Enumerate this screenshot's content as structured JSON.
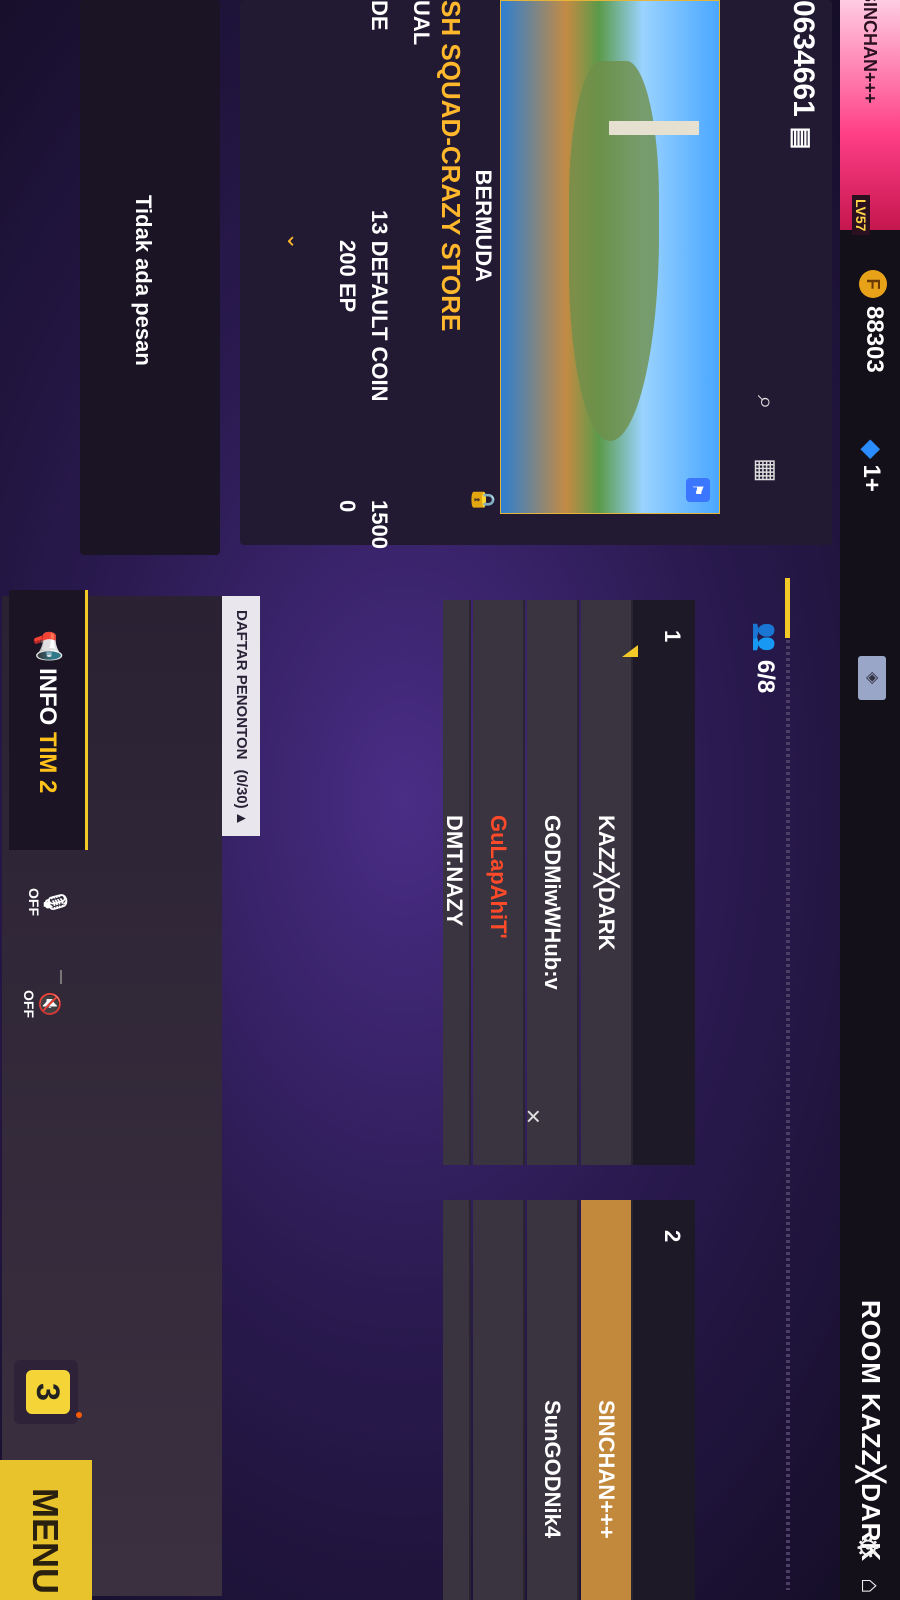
{
  "header": {
    "room_title": "ROOM KAZZ╳DARK",
    "gear_icon": "gear-icon",
    "home_icon": "home-icon",
    "diamonds": "1+",
    "coins": "88303",
    "player_name": "SINCHAN+++",
    "level": "LV57"
  },
  "room": {
    "room_id": "0634661",
    "map_name": "BERMUDA",
    "mode_name": "SH SQUAD-CRAZY STORE",
    "mode_type": "UAL",
    "row1_label": "DE",
    "row1_mid": "13  DEFAULT COIN",
    "row1_val": "1500",
    "row2_mid": "200  EP",
    "row2_val": "0"
  },
  "chat": {
    "empty_text": "Tidak ada pesan"
  },
  "teams": {
    "count": "6/8",
    "team1": {
      "number": "1",
      "players": [
        "KAZZ╳DARK",
        "GODMiwWHub:v",
        "GuLapAhiT'",
        "DMT.NAZY"
      ]
    },
    "team2": {
      "number": "2",
      "players": [
        "SINCHAN+++",
        "SunGODNik4",
        "",
        ""
      ]
    }
  },
  "spectators": {
    "label": "DAFTAR PENONTON",
    "count": "(0/30)"
  },
  "controls": {
    "team_info_prefix": "INFO",
    "team_info_accent": "TIM 2",
    "mic_label": "OFF",
    "speaker_label": "OFF",
    "dice_value": "3",
    "menu_label": "MENU"
  },
  "colors": {
    "accent_yellow": "#f3c928",
    "mode_orange": "#ffb72b",
    "highlight_red": "#ff4a2a",
    "own_slot": "#c2893c"
  }
}
